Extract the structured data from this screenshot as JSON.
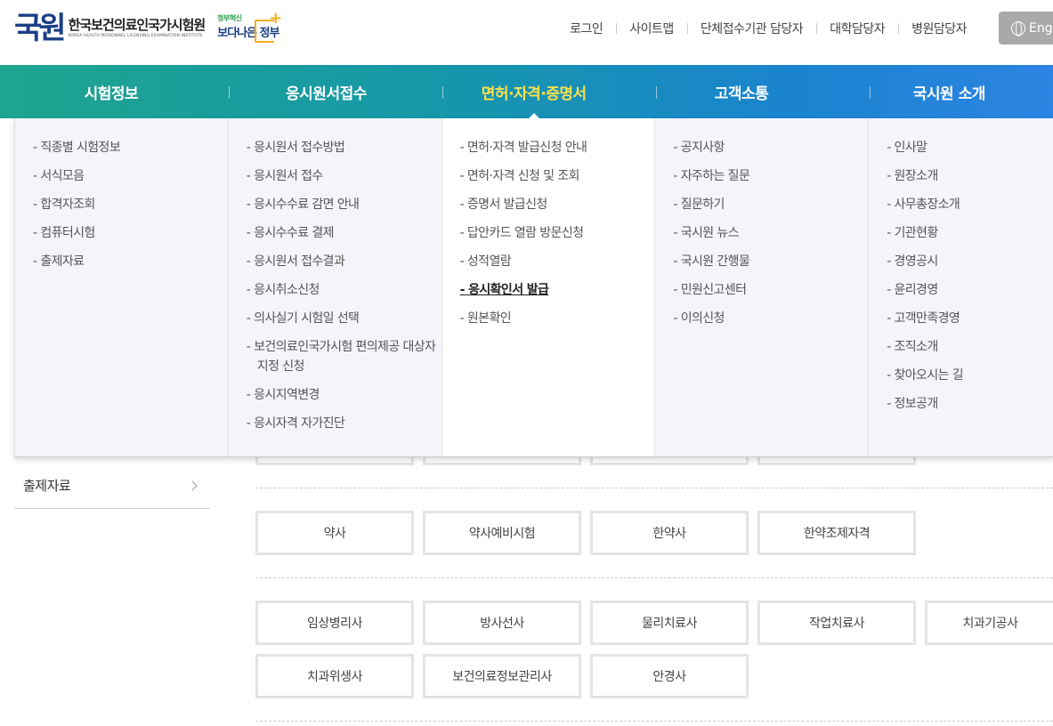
{
  "header": {
    "logo_mark": "국원",
    "logo_ko": "한국보건의료인국가시험원",
    "logo_en": "KOREA HEALTH PERSONNEL LICENSING EXAMINATION INSTITUTE",
    "gov_small": "정부혁신",
    "gov_big": "보다나은 정부",
    "util_links": [
      "로그인",
      "사이트맵",
      "단체접수기관 담당자",
      "대학담당자",
      "병원담당자"
    ],
    "english_label": "Engl"
  },
  "gnb": {
    "items": [
      "시험정보",
      "응시원서접수",
      "면허·자격·증명서",
      "고객소통",
      "국시원 소개"
    ],
    "active_index": 2
  },
  "dropdown": {
    "columns": [
      [
        "직종별 시험정보",
        "서식모음",
        "합격자조회",
        "컴퓨터시험",
        "출제자료"
      ],
      [
        "응시원서 접수방법",
        "응시원서 접수",
        "응시수수료 감면 안내",
        "응시수수료 결제",
        "응시원서 접수결과",
        "응시취소신청",
        "의사실기 시험일 선택",
        "보건의료인국가시험 편의제공 대상자 지정 신청",
        "응시지역변경",
        "응시자격 자가진단"
      ],
      [
        "면허·자격 발급신청 안내",
        "면허·자격 신청 및 조회",
        "증명서 발급신청",
        "답안카드 열람 방문신청",
        "성적열람",
        "응시확인서 발급",
        "원본확인"
      ],
      [
        "공지사항",
        "자주하는 질문",
        "질문하기",
        "국시원 뉴스",
        "국시원 간행물",
        "민원신고센터",
        "이의신청"
      ],
      [
        "인사말",
        "원장소개",
        "사무총장소개",
        "기관현황",
        "경영공시",
        "윤리경영",
        "고객만족경영",
        "조직소개",
        "찾아오시는 길",
        "정보공개"
      ]
    ],
    "current": "응시확인서 발급"
  },
  "sidebar": {
    "item": "출제자료"
  },
  "exam_groups": {
    "group1": [
      "약사",
      "약사예비시험",
      "한약사",
      "한약조제자격"
    ],
    "group2": [
      "임상병리사",
      "방사선사",
      "물리치료사",
      "작업치료사",
      "치과기공사",
      "치과위생사",
      "보건의료정보관리사",
      "안경사"
    ]
  },
  "colors": {
    "gnb_start": "#1fa48f",
    "gnb_end": "#2d84e2",
    "active": "#ffe14d",
    "logo": "#1b3f86"
  }
}
